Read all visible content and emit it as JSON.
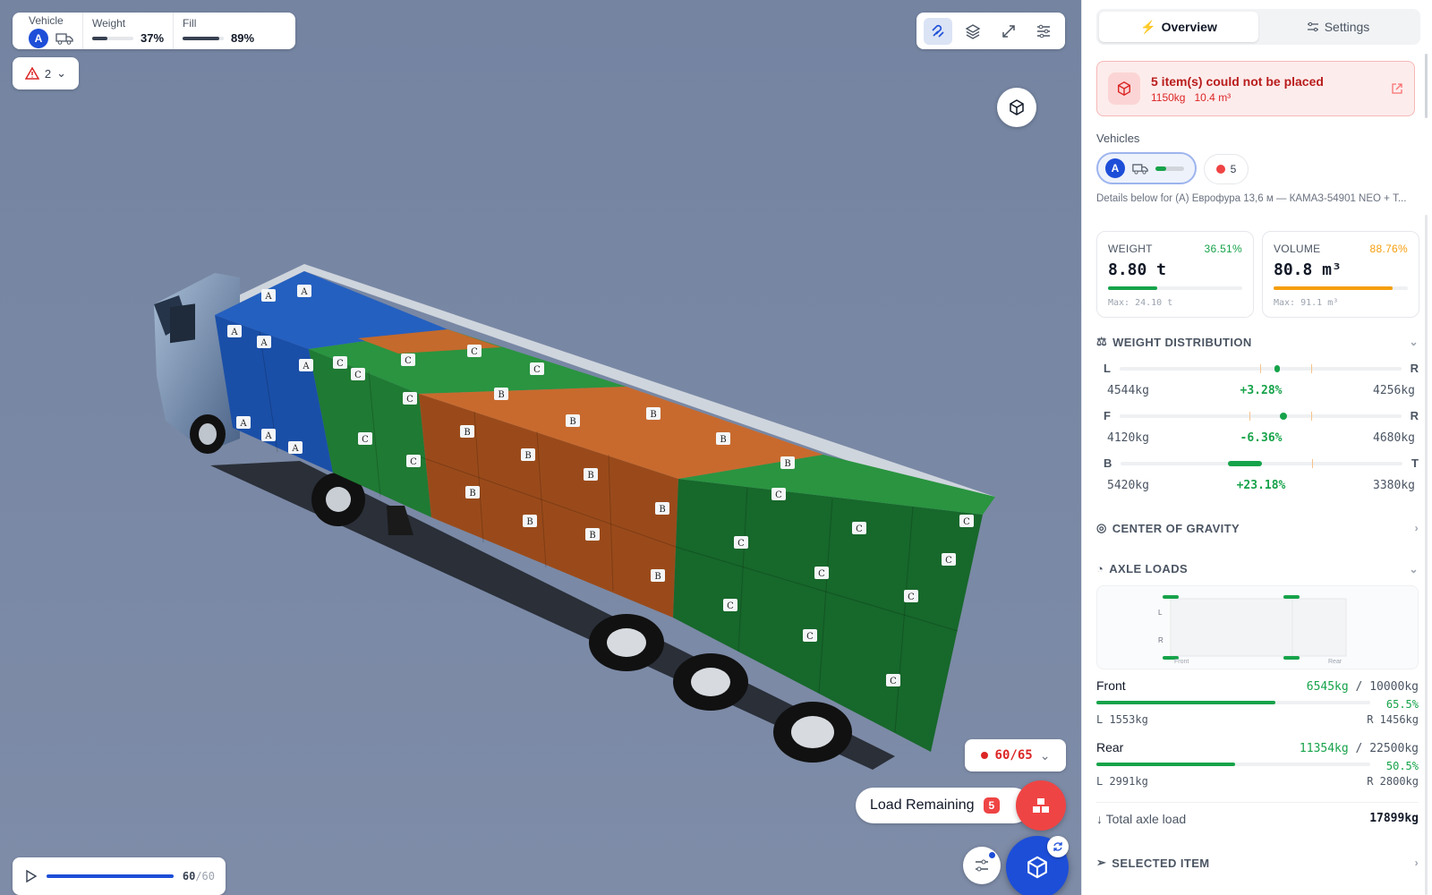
{
  "status": {
    "vehicle_label": "Vehicle",
    "vehicle_badge": "A",
    "weight_label": "Weight",
    "weight_value": "37%",
    "weight_fraction": 0.37,
    "fill_label": "Fill",
    "fill_value": "89%",
    "fill_fraction": 0.89
  },
  "warnings": {
    "count": "2"
  },
  "toolbar": {
    "icons": [
      "magnet-icon",
      "layers-icon",
      "expand-icon",
      "sliders-icon"
    ]
  },
  "cargo": {
    "labels": [
      "A",
      "B",
      "C"
    ],
    "colors": {
      "A": "#1a4fa8",
      "B": "#b25a22",
      "C": "#1f7a33"
    }
  },
  "load_counter": {
    "text": "60/65"
  },
  "load_remaining": {
    "label": "Load Remaining",
    "count": "5"
  },
  "playback": {
    "counter_current": "60",
    "counter_total": "/60",
    "progress": 1.0
  },
  "panel": {
    "tabs": [
      {
        "label": "Overview",
        "active": true
      },
      {
        "label": "Settings",
        "active": false
      }
    ],
    "alert": {
      "title": "5 item(s) could not be placed",
      "weight": "1150kg",
      "volume": "10.4 m³"
    },
    "vehicles_label": "Vehicles",
    "vehicle_badge": "A",
    "unplaced_count": "5",
    "details": "Details below for (A) Еврофура 13,6 м — КАМАЗ-54901 NEO + Т...",
    "weight": {
      "label": "WEIGHT",
      "pct": "36.51%",
      "value": "8.80 t",
      "max": "Max: 24.10 t",
      "fraction": 0.3651,
      "color": "#16a34a"
    },
    "volume": {
      "label": "VOLUME",
      "pct": "88.76%",
      "value": "80.8 m³",
      "max": "Max: 91.1 m³",
      "fraction": 0.8876,
      "color": "#f59e0b"
    },
    "weight_distribution": {
      "title": "WEIGHT DISTRIBUTION",
      "rows": [
        {
          "left": "L",
          "right": "R",
          "left_val": "4544kg",
          "pct": "+3.28%",
          "right_val": "4256kg"
        },
        {
          "left": "F",
          "right": "R",
          "left_val": "4120kg",
          "pct": "-6.36%",
          "right_val": "4680kg"
        },
        {
          "left": "B",
          "right": "T",
          "left_val": "5420kg",
          "pct": "+23.18%",
          "right_val": "3380kg"
        }
      ]
    },
    "cog_title": "CENTER OF GRAVITY",
    "axle": {
      "title": "AXLE LOADS",
      "diagram": {
        "l": "L",
        "r": "R",
        "front": "Front",
        "rear": "Rear"
      },
      "front": {
        "name": "Front",
        "load": "6545kg",
        "sep": "/",
        "cap": "10000kg",
        "pct": "65.5%",
        "fraction": 0.655,
        "l": "L 1553kg",
        "r": "R 1456kg"
      },
      "rear": {
        "name": "Rear",
        "load": "11354kg",
        "sep": "/",
        "cap": "22500kg",
        "pct": "50.5%",
        "fraction": 0.505,
        "l": "L 2991kg",
        "r": "R 2800kg"
      },
      "total_label": "Total axle load",
      "total_value": "17899kg"
    },
    "selected_title": "SELECTED ITEM"
  }
}
